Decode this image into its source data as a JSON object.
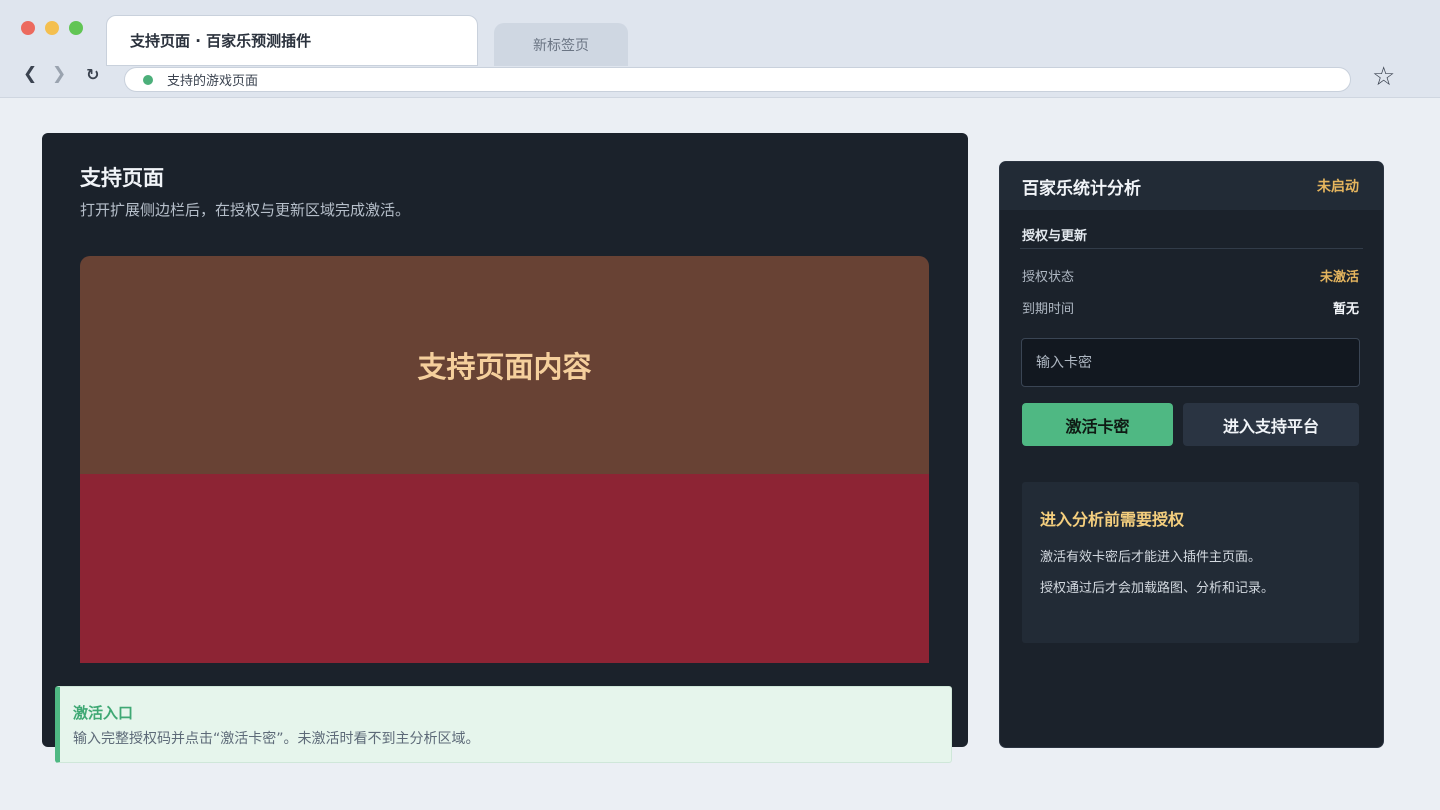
{
  "browser": {
    "active_tab": "支持页面 · 百家乐预测插件",
    "inactive_tab": "新标签页",
    "address": "支持的游戏页面",
    "back_icon": "❮",
    "forward_icon": "❯",
    "reload_icon": "↻",
    "star_icon": "☆"
  },
  "page": {
    "title": "支持页面",
    "subtitle": "打开扩展侧边栏后，在授权与更新区域完成激活。",
    "game_placeholder": "支持页面内容"
  },
  "notice": {
    "title": "激活入口",
    "text": "输入完整授权码并点击“激活卡密”。未激活时看不到主分析区域。"
  },
  "sidebar": {
    "title": "百家乐统计分析",
    "status": "未启动",
    "section_title": "授权与更新",
    "auth_status_label": "授权状态",
    "auth_status_value": "未激活",
    "expiry_label": "到期时间",
    "expiry_value": "暂无",
    "card_input_placeholder": "输入卡密",
    "activate_button": "激活卡密",
    "support_button": "进入支持平台",
    "auth_box": {
      "title": "进入分析前需要授权",
      "line1": "激活有效卡密后才能进入插件主页面。",
      "line2": "授权通过后才会加载路图、分析和记录。"
    }
  },
  "colors": {
    "accent_green": "#4fb883",
    "warn_yellow": "#e5b55e",
    "panel_dark": "#1b222b",
    "game_brown": "#684234",
    "game_red": "#8d2434"
  }
}
